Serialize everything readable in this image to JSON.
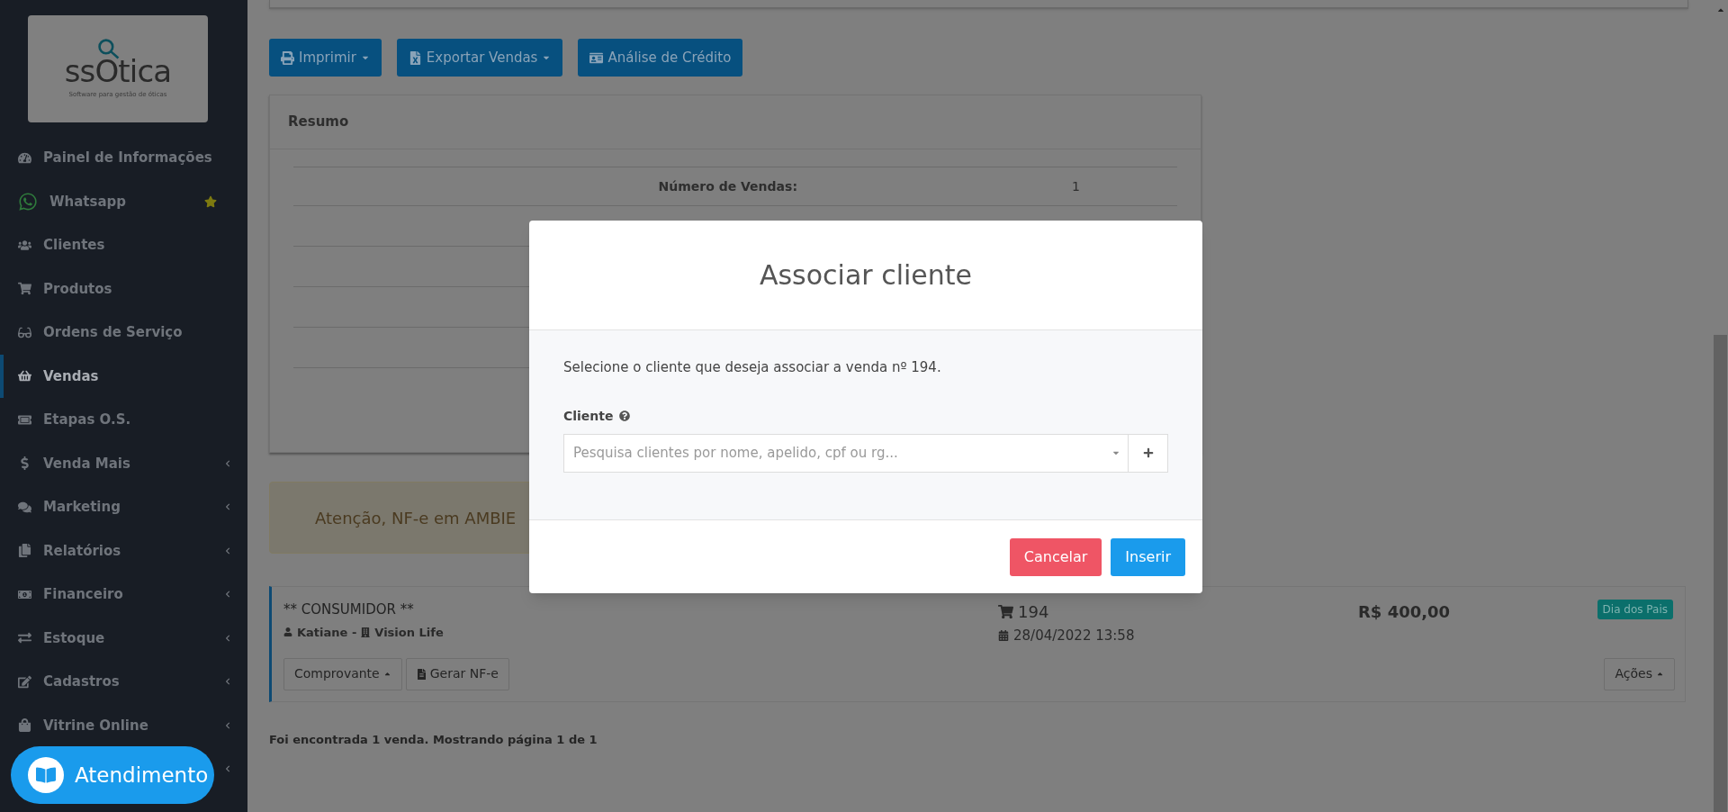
{
  "sidebar": {
    "logo": {
      "name": "ssOtica",
      "tagline": "Software para gestão de óticas"
    },
    "items": [
      {
        "label": "Painel de Informações",
        "selected": false,
        "expandable": false,
        "starred": false
      },
      {
        "label": "Whatsapp",
        "selected": false,
        "expandable": false,
        "starred": true
      },
      {
        "label": "Clientes",
        "selected": false,
        "expandable": false,
        "starred": false
      },
      {
        "label": "Produtos",
        "selected": false,
        "expandable": false,
        "starred": false
      },
      {
        "label": "Ordens de Serviço",
        "selected": false,
        "expandable": false,
        "starred": false
      },
      {
        "label": "Vendas",
        "selected": true,
        "expandable": false,
        "starred": false
      },
      {
        "label": "Etapas O.S.",
        "selected": false,
        "expandable": false,
        "starred": false
      },
      {
        "label": "Venda Mais",
        "selected": false,
        "expandable": true,
        "starred": false
      },
      {
        "label": "Marketing",
        "selected": false,
        "expandable": true,
        "starred": false
      },
      {
        "label": "Relatórios",
        "selected": false,
        "expandable": true,
        "starred": false
      },
      {
        "label": "Financeiro",
        "selected": false,
        "expandable": true,
        "starred": false
      },
      {
        "label": "Estoque",
        "selected": false,
        "expandable": true,
        "starred": false
      },
      {
        "label": "Cadastros",
        "selected": false,
        "expandable": true,
        "starred": false
      },
      {
        "label": "Vitrine Online",
        "selected": false,
        "expandable": true,
        "starred": false
      },
      {
        "selected": false,
        "expandable": true,
        "starred": false
      }
    ]
  },
  "support_button": {
    "label": "Atendimento"
  },
  "toolbar": [
    {
      "label": "Imprimir",
      "dropdown": true
    },
    {
      "label": "Exportar Vendas",
      "dropdown": true
    },
    {
      "label": "Análise de Crédito",
      "dropdown": false
    }
  ],
  "summary": {
    "title": "Resumo",
    "rows": [
      {
        "label": "Número de Vendas:",
        "value": "1"
      }
    ]
  },
  "alert": {
    "text": "Atenção, NF-e em AMBIE"
  },
  "sale": {
    "customer": "** CONSUMIDOR **",
    "seller": "Katiane -",
    "store": "Vision Life",
    "number": "194",
    "date": "28/04/2022 13:58",
    "total": "R$ 400,00",
    "tag": "Dia dos Pais",
    "buttons": [
      "Comprovante",
      "Gerar NF-e"
    ],
    "actions": "Ações"
  },
  "footer": "Foi encontrada 1 venda. Mostrando página 1 de 1",
  "modal": {
    "title": "Associar cliente",
    "message": "Selecione o cliente que deseja associar a venda nº 194.",
    "field_label": "Cliente",
    "placeholder": "Pesquisa clientes por nome, apelido, cpf ou rg...",
    "buttons": [
      {
        "label": "Cancelar",
        "kind": "danger"
      },
      {
        "label": "Inserir",
        "kind": "primary"
      }
    ]
  }
}
